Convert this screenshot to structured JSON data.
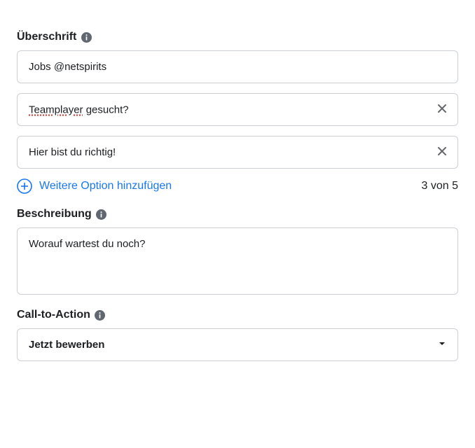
{
  "headline": {
    "label": "Überschrift",
    "options": [
      {
        "value": "Jobs @netspirits",
        "removable": false
      },
      {
        "value_part1": "Teamplayer",
        "value_part2": " gesucht?",
        "spellflag": true,
        "removable": true
      },
      {
        "value": "Hier bist du richtig!",
        "removable": true
      }
    ],
    "add_label": "Weitere Option hinzufügen",
    "counter": "3 von 5"
  },
  "description": {
    "label": "Beschreibung",
    "value": "Worauf wartest du noch?"
  },
  "cta": {
    "label": "Call-to-Action",
    "selected": "Jetzt bewerben"
  }
}
